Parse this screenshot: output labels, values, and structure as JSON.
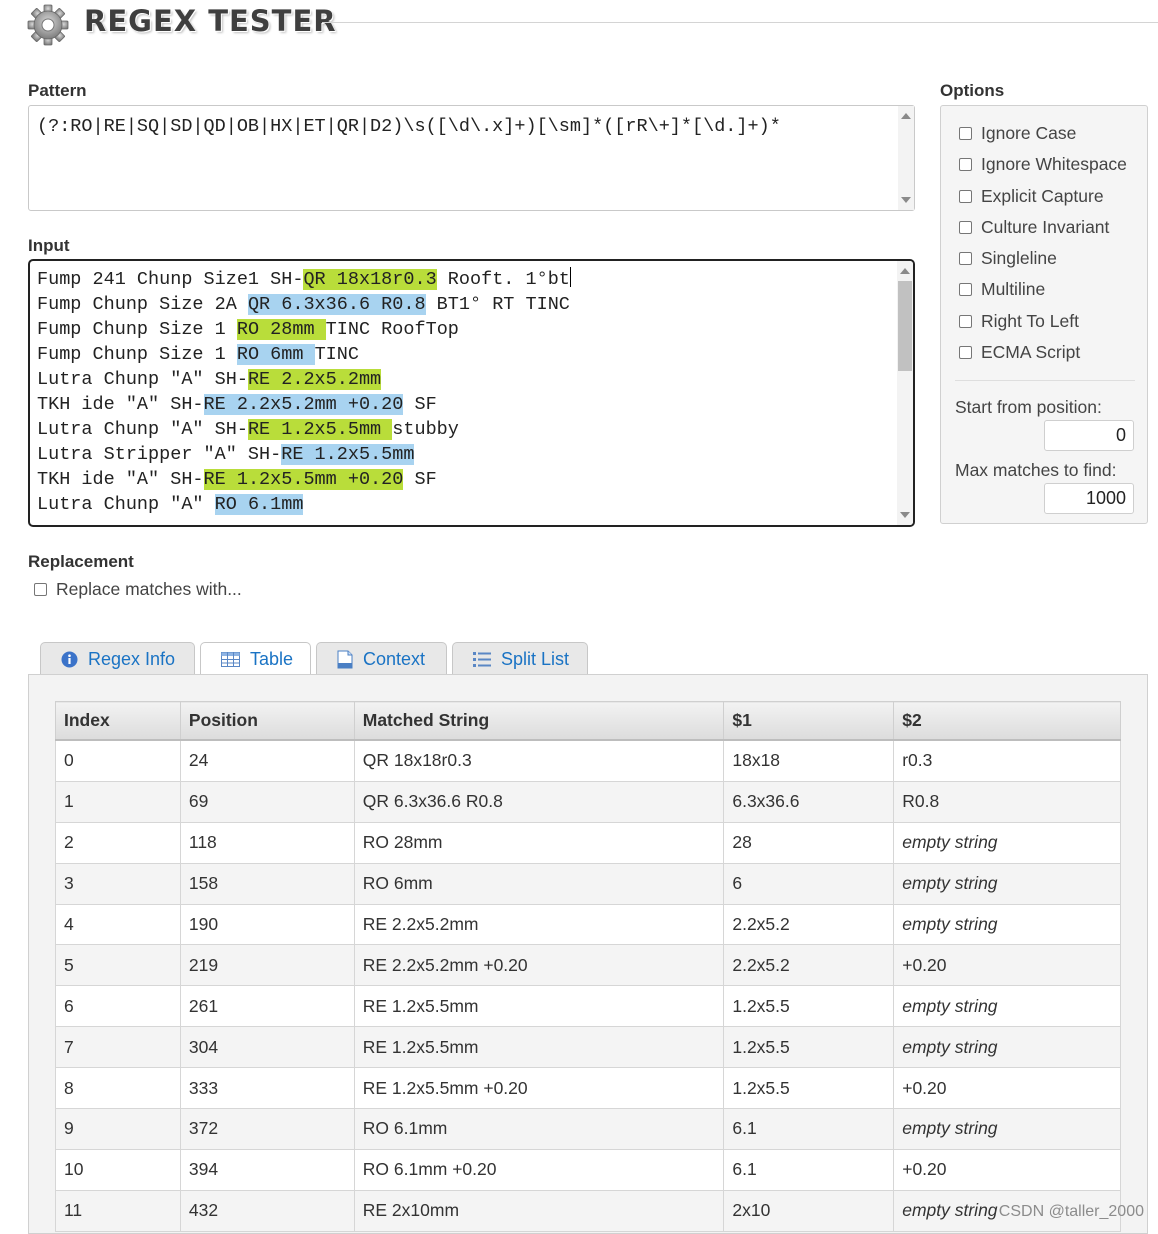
{
  "header": {
    "title": "REGEX TESTER"
  },
  "pattern": {
    "label": "Pattern",
    "value": "(?:RO|RE|SQ|SD|QD|OB|HX|ET|QR|D2)\\s([\\d\\.x]+)[\\sm]*([rR\\+]*[\\d.]+)*"
  },
  "input": {
    "label": "Input",
    "lines": [
      [
        {
          "t": "Fump 241 Chunp Size1 SH-"
        },
        {
          "t": "QR 18x18r0.3",
          "h": "g"
        },
        {
          "t": " Rooft. 1°bt"
        }
      ],
      [
        {
          "t": "Fump Chunp Size 2A "
        },
        {
          "t": "QR 6.3x36.6 R0.8",
          "h": "b"
        },
        {
          "t": " BT1° RT TINC"
        }
      ],
      [
        {
          "t": "Fump Chunp Size 1 "
        },
        {
          "t": "RO 28mm ",
          "h": "g"
        },
        {
          "t": "TINC RoofTop"
        }
      ],
      [
        {
          "t": "Fump Chunp Size 1 "
        },
        {
          "t": "RO 6mm ",
          "h": "b"
        },
        {
          "t": "TINC"
        }
      ],
      [
        {
          "t": "Lutra Chunp \"A\" SH-"
        },
        {
          "t": "RE 2.2x5.2mm",
          "h": "g"
        }
      ],
      [
        {
          "t": "TKH ide \"A\" SH-"
        },
        {
          "t": "RE 2.2x5.2mm +0.20",
          "h": "b"
        },
        {
          "t": " SF"
        }
      ],
      [
        {
          "t": "Lutra Chunp \"A\" SH-"
        },
        {
          "t": "RE 1.2x5.5mm ",
          "h": "g"
        },
        {
          "t": "stubby"
        }
      ],
      [
        {
          "t": "Lutra Stripper \"A\" SH-"
        },
        {
          "t": "RE 1.2x5.5mm",
          "h": "b"
        }
      ],
      [
        {
          "t": "TKH ide \"A\" SH-"
        },
        {
          "t": "RE 1.2x5.5mm +0.20",
          "h": "g"
        },
        {
          "t": " SF"
        }
      ],
      [
        {
          "t": "Lutra Chunp \"A\" "
        },
        {
          "t": "RO 6.1mm",
          "h": "b"
        }
      ]
    ]
  },
  "options": {
    "label": "Options",
    "checkboxes": [
      "Ignore Case",
      "Ignore Whitespace",
      "Explicit Capture",
      "Culture Invariant",
      "Singleline",
      "Multiline",
      "Right To Left",
      "ECMA Script"
    ],
    "start_label": "Start from position:",
    "start_value": "0",
    "max_label": "Max matches to find:",
    "max_value": "1000"
  },
  "replacement": {
    "label": "Replacement",
    "checkbox_label": "Replace matches with..."
  },
  "tabs": [
    {
      "label": "Regex Info",
      "icon": "info-icon"
    },
    {
      "label": "Table",
      "icon": "table-icon"
    },
    {
      "label": "Context",
      "icon": "document-icon"
    },
    {
      "label": "Split List",
      "icon": "list-icon"
    }
  ],
  "active_tab": "Table",
  "table": {
    "columns": [
      "Index",
      "Position",
      "Matched String",
      "$1",
      "$2"
    ],
    "rows": [
      [
        "0",
        "24",
        "QR 18x18r0.3",
        "18x18",
        "r0.3"
      ],
      [
        "1",
        "69",
        "QR 6.3x36.6 R0.8",
        "6.3x36.6",
        "R0.8"
      ],
      [
        "2",
        "118",
        "RO 28mm",
        "28",
        "empty string"
      ],
      [
        "3",
        "158",
        "RO 6mm",
        "6",
        "empty string"
      ],
      [
        "4",
        "190",
        "RE 2.2x5.2mm",
        "2.2x5.2",
        "empty string"
      ],
      [
        "5",
        "219",
        "RE 2.2x5.2mm +0.20",
        "2.2x5.2",
        "+0.20"
      ],
      [
        "6",
        "261",
        "RE 1.2x5.5mm",
        "1.2x5.5",
        "empty string"
      ],
      [
        "7",
        "304",
        "RE 1.2x5.5mm",
        "1.2x5.5",
        "empty string"
      ],
      [
        "8",
        "333",
        "RE 1.2x5.5mm +0.20",
        "1.2x5.5",
        "+0.20"
      ],
      [
        "9",
        "372",
        "RO 6.1mm",
        "6.1",
        "empty string"
      ],
      [
        "10",
        "394",
        "RO 6.1mm +0.20",
        "6.1",
        "+0.20"
      ],
      [
        "11",
        "432",
        "RE 2x10mm",
        "2x10",
        "empty string"
      ]
    ]
  },
  "watermark": "CSDN @taller_2000",
  "colors": {
    "match_green": "#b9dd3a",
    "match_blue": "#a8d3f0",
    "tab_link": "#1a73c4"
  }
}
